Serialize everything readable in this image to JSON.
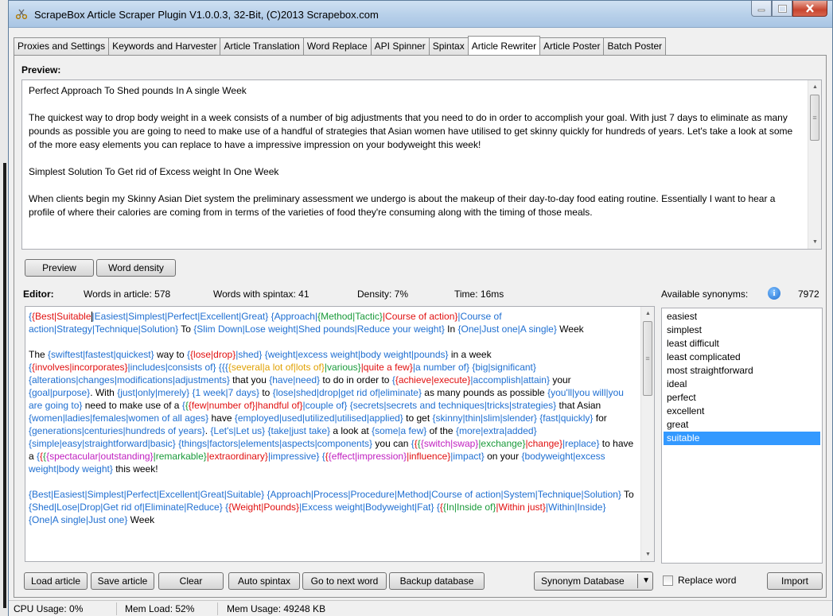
{
  "window": {
    "title": "ScrapeBox Article Scraper Plugin V1.0.0.3, 32-Bit, (C)2013 Scrapebox.com"
  },
  "tabs": [
    {
      "label": "Proxies and Settings"
    },
    {
      "label": "Keywords and Harvester"
    },
    {
      "label": "Article Translation"
    },
    {
      "label": "Word Replace"
    },
    {
      "label": "API Spinner"
    },
    {
      "label": "Spintax"
    },
    {
      "label": "Article Rewriter",
      "active": true
    },
    {
      "label": "Article Poster"
    },
    {
      "label": "Batch Poster"
    }
  ],
  "preview": {
    "label": "Preview:",
    "paragraphs": [
      "Perfect Approach To Shed pounds In A single Week",
      "The quickest way to drop body weight in a week consists of a number of big adjustments that you need to do in order to accomplish your goal. With just 7 days to eliminate as many pounds as possible you are going to need to make use of a handful of strategies that Asian women have utilised to get skinny quickly for hundreds of years. Let's take a look at some of the more easy elements you can replace to have a impressive impression on your bodyweight this week!",
      "Simplest Solution To Get rid of Excess weight In One Week",
      "When clients begin my Skinny Asian Diet system the preliminary assessment we undergo is about the makeup of their day-to-day food eating routine. Essentially I want to hear a profile of where their calories are coming from in terms of the varieties of food they're consuming along with the timing of those meals."
    ],
    "preview_button": "Preview",
    "density_button": "Word density"
  },
  "editor": {
    "label": "Editor:",
    "words_in_article": "Words in article:  578",
    "words_with_spintax": "Words with spintax:  41",
    "density": "Density:  7%",
    "time": "Time:  16ms",
    "p1": [
      {
        "c": "b",
        "t": "{"
      },
      {
        "c": "r",
        "t": "{Best|Suitable"
      },
      {
        "c": "caret",
        "t": ""
      },
      {
        "c": "b",
        "t": "|Easiest|Simplest|Perfect|Excellent|Great}"
      },
      {
        "c": "",
        "t": " "
      },
      {
        "c": "b",
        "t": "{Approach|"
      },
      {
        "c": "g",
        "t": "{Method|Tactic}"
      },
      {
        "c": "r",
        "t": "|Course of action}"
      },
      {
        "c": "b",
        "t": "|Course of action|Strategy|Technique|Solution}"
      },
      {
        "c": "",
        "t": " To "
      },
      {
        "c": "b",
        "t": "{Slim Down|Lose weight|Shed pounds|Reduce your weight}"
      },
      {
        "c": "",
        "t": " In "
      },
      {
        "c": "b",
        "t": "{One|Just one|A single}"
      },
      {
        "c": "",
        "t": " Week"
      }
    ],
    "p2": [
      {
        "c": "",
        "t": "The "
      },
      {
        "c": "b",
        "t": "{swiftest|fastest|quickest}"
      },
      {
        "c": "",
        "t": " way to "
      },
      {
        "c": "b",
        "t": "{"
      },
      {
        "c": "r",
        "t": "{lose|drop}"
      },
      {
        "c": "b",
        "t": "|shed}"
      },
      {
        "c": "",
        "t": " "
      },
      {
        "c": "b",
        "t": "{weight|excess weight|body weight|pounds}"
      },
      {
        "c": "",
        "t": " in a week "
      },
      {
        "c": "b",
        "t": "{"
      },
      {
        "c": "r",
        "t": "{involves|incorporates}"
      },
      {
        "c": "b",
        "t": "|includes|consists of}"
      },
      {
        "c": "",
        "t": " "
      },
      {
        "c": "b",
        "t": "{{{"
      },
      {
        "c": "o",
        "t": "{several|a lot of|lots of}"
      },
      {
        "c": "g",
        "t": "|various}"
      },
      {
        "c": "r",
        "t": "|quite a few}"
      },
      {
        "c": "b",
        "t": "|a number of}"
      },
      {
        "c": "",
        "t": " "
      },
      {
        "c": "b",
        "t": "{big|significant}"
      },
      {
        "c": "",
        "t": " "
      },
      {
        "c": "b",
        "t": "{alterations|changes|modifications|adjustments}"
      },
      {
        "c": "",
        "t": " that you "
      },
      {
        "c": "b",
        "t": "{have|need}"
      },
      {
        "c": "",
        "t": " to do in order to "
      },
      {
        "c": "b",
        "t": "{"
      },
      {
        "c": "r",
        "t": "{achieve|execute}"
      },
      {
        "c": "b",
        "t": "|accomplish|attain}"
      },
      {
        "c": "",
        "t": " your "
      },
      {
        "c": "b",
        "t": "{goal|purpose}"
      },
      {
        "c": "",
        "t": ". With "
      },
      {
        "c": "b",
        "t": "{just|only|merely}"
      },
      {
        "c": "",
        "t": " "
      },
      {
        "c": "b",
        "t": "{1 week|7 days}"
      },
      {
        "c": "",
        "t": " to "
      },
      {
        "c": "b",
        "t": "{lose|shed|drop|get rid of|eliminate}"
      },
      {
        "c": "",
        "t": " as many pounds as possible "
      },
      {
        "c": "b",
        "t": "{you'll|you will|you are going to}"
      },
      {
        "c": "",
        "t": " need to make use of a "
      },
      {
        "c": "b",
        "t": "{"
      },
      {
        "c": "g",
        "t": "{"
      },
      {
        "c": "r",
        "t": "{few|number of}"
      },
      {
        "c": "r",
        "t": "|handful of}"
      },
      {
        "c": "b",
        "t": "|couple of}"
      },
      {
        "c": "",
        "t": " "
      },
      {
        "c": "b",
        "t": "{secrets|secrets and techniques|tricks|strategies}"
      },
      {
        "c": "",
        "t": " that Asian "
      },
      {
        "c": "b",
        "t": "{women|ladies|females|women of all ages}"
      },
      {
        "c": "",
        "t": " have "
      },
      {
        "c": "b",
        "t": "{employed|used|utilized|utilised|applied}"
      },
      {
        "c": "",
        "t": " to get "
      },
      {
        "c": "b",
        "t": "{skinny|thin|slim|slender}"
      },
      {
        "c": "",
        "t": " "
      },
      {
        "c": "b",
        "t": "{fast|quickly}"
      },
      {
        "c": "",
        "t": " for "
      },
      {
        "c": "b",
        "t": "{generations|centuries|hundreds of years}"
      },
      {
        "c": "",
        "t": ". "
      },
      {
        "c": "b",
        "t": "{Let's|Let us}"
      },
      {
        "c": "",
        "t": " "
      },
      {
        "c": "b",
        "t": "{take|just take}"
      },
      {
        "c": "",
        "t": " a look at "
      },
      {
        "c": "b",
        "t": "{some|a few}"
      },
      {
        "c": "",
        "t": " of the "
      },
      {
        "c": "b",
        "t": "{more|extra|added}"
      },
      {
        "c": "",
        "t": " "
      },
      {
        "c": "b",
        "t": "{simple|easy|straightforward|basic}"
      },
      {
        "c": "",
        "t": " "
      },
      {
        "c": "b",
        "t": "{things|factors|elements|aspects|components}"
      },
      {
        "c": "",
        "t": " you can "
      },
      {
        "c": "b",
        "t": "{"
      },
      {
        "c": "r",
        "t": "{"
      },
      {
        "c": "g",
        "t": "{"
      },
      {
        "c": "m",
        "t": "{switch|swap}"
      },
      {
        "c": "g",
        "t": "|exchange}"
      },
      {
        "c": "r",
        "t": "|change}"
      },
      {
        "c": "b",
        "t": "|replace}"
      },
      {
        "c": "",
        "t": " to have a "
      },
      {
        "c": "b",
        "t": "{"
      },
      {
        "c": "r",
        "t": "{"
      },
      {
        "c": "g",
        "t": "{"
      },
      {
        "c": "m",
        "t": "{spectacular|outstanding}"
      },
      {
        "c": "g",
        "t": "|remarkable}"
      },
      {
        "c": "r",
        "t": "|extraordinary}"
      },
      {
        "c": "b",
        "t": "|impressive}"
      },
      {
        "c": "",
        "t": " "
      },
      {
        "c": "b",
        "t": "{"
      },
      {
        "c": "r",
        "t": "{"
      },
      {
        "c": "m",
        "t": "{effect|impression}"
      },
      {
        "c": "r",
        "t": "|influence}"
      },
      {
        "c": "b",
        "t": "|impact}"
      },
      {
        "c": "",
        "t": " on your "
      },
      {
        "c": "b",
        "t": "{bodyweight|excess weight|body weight}"
      },
      {
        "c": "",
        "t": " this week!"
      }
    ],
    "p3": [
      {
        "c": "b",
        "t": "{Best|Easiest|Simplest|Perfect|Excellent|Great|Suitable}"
      },
      {
        "c": "",
        "t": " "
      },
      {
        "c": "b",
        "t": "{Approach|Process|Procedure|Method|Course of action|System|Technique|Solution}"
      },
      {
        "c": "",
        "t": " To "
      },
      {
        "c": "b",
        "t": "{Shed|Lose|Drop|Get rid of|Eliminate|Reduce}"
      },
      {
        "c": "",
        "t": " "
      },
      {
        "c": "b",
        "t": "{"
      },
      {
        "c": "r",
        "t": "{Weight|Pounds}"
      },
      {
        "c": "b",
        "t": "|Excess weight|Bodyweight|Fat}"
      },
      {
        "c": "",
        "t": " "
      },
      {
        "c": "b",
        "t": "{"
      },
      {
        "c": "r",
        "t": "{"
      },
      {
        "c": "g",
        "t": "{In|Inside of}"
      },
      {
        "c": "r",
        "t": "|Within just}"
      },
      {
        "c": "b",
        "t": "|Within|Inside}"
      },
      {
        "c": "",
        "t": " "
      },
      {
        "c": "b",
        "t": "{One|A single|Just one}"
      },
      {
        "c": "",
        "t": " Week"
      }
    ]
  },
  "synonyms": {
    "label": "Available synonyms:",
    "count": "7972",
    "items": [
      "easiest",
      "simplest",
      "least difficult",
      "least complicated",
      "most straightforward",
      "ideal",
      "perfect",
      "excellent",
      "great",
      "suitable"
    ],
    "selected_index": 9
  },
  "toolbar": {
    "load": "Load article",
    "save": "Save article",
    "clear": "Clear",
    "auto_spintax": "Auto spintax",
    "next_word": "Go to next word",
    "backup": "Backup database",
    "synonym_db": "Synonym Database",
    "replace_word": "Replace word",
    "import": "Import"
  },
  "status": {
    "cpu": "CPU Usage:  0%",
    "mem_load": "Mem Load:  52%",
    "mem_usage": "Mem Usage:  49248 KB"
  },
  "colors": {
    "spintax_blue": "#1f6fd1",
    "spintax_red": "#e01010",
    "spintax_green": "#1a9a3a",
    "spintax_orange": "#e0a000",
    "spintax_magenta": "#c020c0",
    "selection": "#3399ff"
  }
}
